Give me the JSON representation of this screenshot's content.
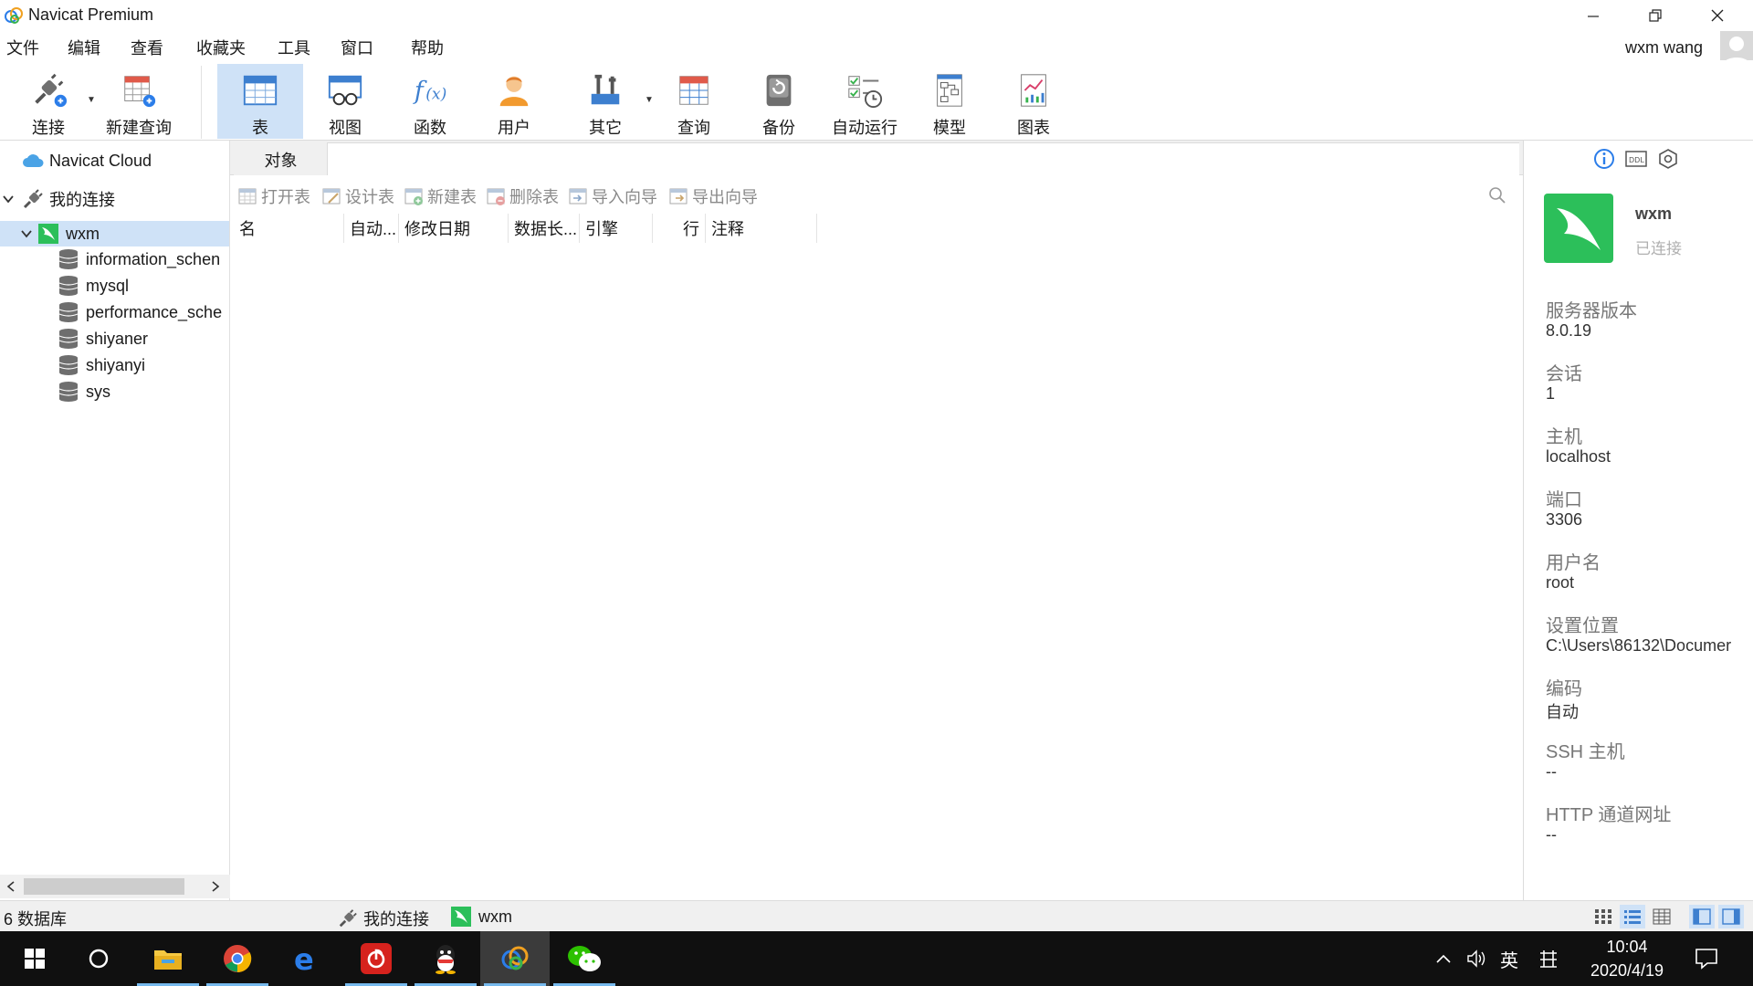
{
  "app": {
    "title": "Navicat Premium"
  },
  "menu": {
    "items": [
      "文件",
      "编辑",
      "查看",
      "收藏夹",
      "工具",
      "窗口",
      "帮助"
    ]
  },
  "user": {
    "name": "wxm wang"
  },
  "toolbar": {
    "buttons": [
      {
        "label": "连接",
        "icon": "connect-plug-icon"
      },
      {
        "label": "新建查询",
        "icon": "new-query-icon"
      },
      {
        "label": "表",
        "icon": "table-icon",
        "active": true
      },
      {
        "label": "视图",
        "icon": "view-glasses-icon"
      },
      {
        "label": "函数",
        "icon": "function-fx-icon"
      },
      {
        "label": "用户",
        "icon": "user-icon"
      },
      {
        "label": "其它",
        "icon": "other-tools-icon"
      },
      {
        "label": "查询",
        "icon": "query-icon"
      },
      {
        "label": "备份",
        "icon": "backup-icon"
      },
      {
        "label": "自动运行",
        "icon": "auto-run-icon"
      },
      {
        "label": "模型",
        "icon": "model-icon"
      },
      {
        "label": "图表",
        "icon": "chart-icon"
      }
    ]
  },
  "nav": {
    "cloud": "Navicat Cloud",
    "group": "我的连接",
    "connection": "wxm",
    "databases": [
      "information_schen",
      "mysql",
      "performance_sche",
      "shiyaner",
      "shiyanyi",
      "sys"
    ]
  },
  "main": {
    "tab": "对象",
    "actions": [
      "打开表",
      "设计表",
      "新建表",
      "删除表",
      "导入向导",
      "导出向导"
    ],
    "columns": [
      "名",
      "自动...",
      "修改日期",
      "数据长...",
      "引擎",
      "行",
      "注释"
    ]
  },
  "info": {
    "name": "wxm",
    "status": "已连接",
    "fields": [
      {
        "label": "服务器版本",
        "value": "8.0.19"
      },
      {
        "label": "会话",
        "value": "1"
      },
      {
        "label": "主机",
        "value": "localhost"
      },
      {
        "label": "端口",
        "value": "3306"
      },
      {
        "label": "用户名",
        "value": "root"
      },
      {
        "label": "设置位置",
        "value": "C:\\Users\\86132\\Documer"
      },
      {
        "label": "编码",
        "value": "自动"
      },
      {
        "label": "SSH 主机",
        "value": "--"
      },
      {
        "label": "HTTP 通道网址",
        "value": "--"
      }
    ]
  },
  "status": {
    "count": "6 数据库",
    "crumb_group": "我的连接",
    "crumb_conn": "wxm"
  },
  "taskbar": {
    "ime": "英",
    "time": "10:04",
    "date": "2020/4/19"
  },
  "colors": {
    "accent": "#cfe2f7",
    "mysql_green": "#2cbf5a",
    "taskbar": "#101010"
  }
}
